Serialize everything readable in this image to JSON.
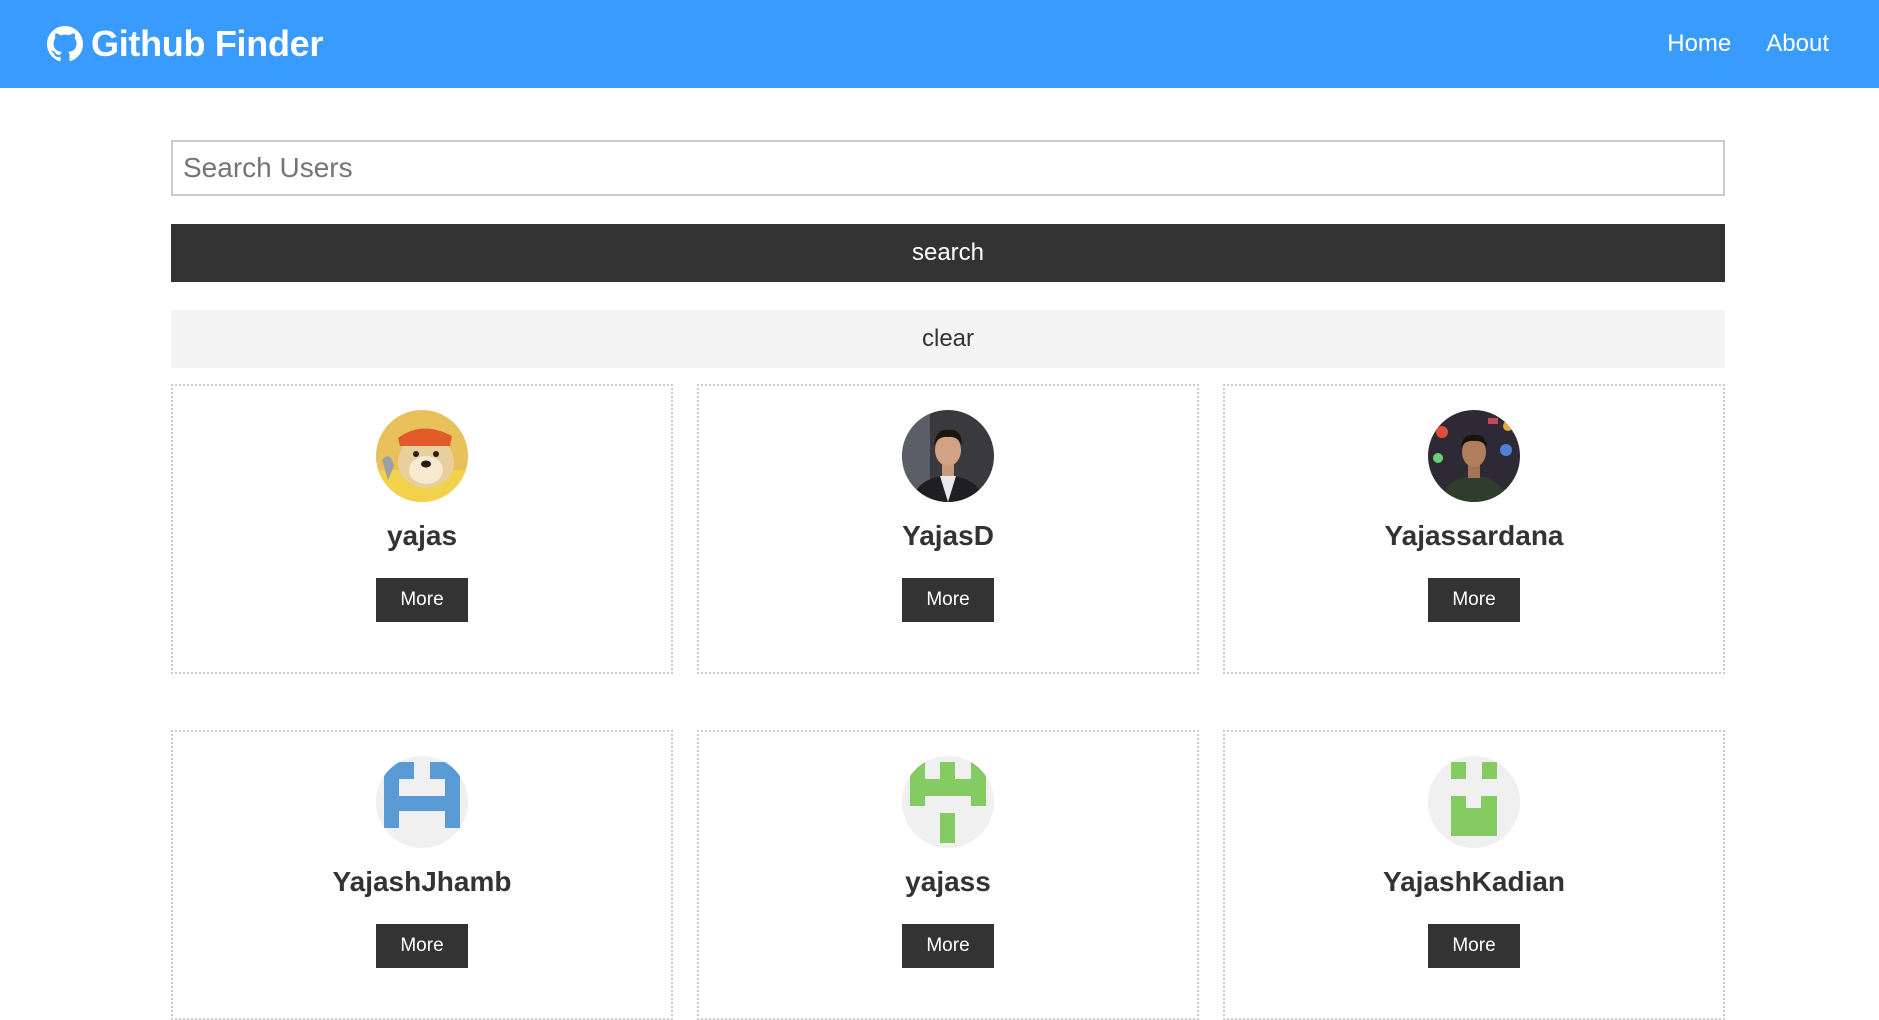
{
  "navbar": {
    "title": "Github Finder",
    "icon": "github-icon",
    "links": [
      "Home",
      "About"
    ]
  },
  "search": {
    "placeholder": "Search Users",
    "value": "",
    "search_label": "search",
    "clear_label": "clear"
  },
  "users": [
    {
      "login": "yajas",
      "more_label": "More",
      "avatar": "doge-avatar"
    },
    {
      "login": "YajasD",
      "more_label": "More",
      "avatar": "photo-avatar"
    },
    {
      "login": "Yajassardana",
      "more_label": "More",
      "avatar": "photo-avatar"
    },
    {
      "login": "YajashJhamb",
      "more_label": "More",
      "avatar": "identicon-avatar"
    },
    {
      "login": "yajass",
      "more_label": "More",
      "avatar": "identicon-avatar"
    },
    {
      "login": "YajashKadian",
      "more_label": "More",
      "avatar": "identicon-avatar"
    }
  ],
  "colors": {
    "navbar": "#3a9bff",
    "dark": "#333333",
    "light": "#f4f4f4",
    "identicon_blue": "#5b9bd5",
    "identicon_green": "#84cc62"
  }
}
